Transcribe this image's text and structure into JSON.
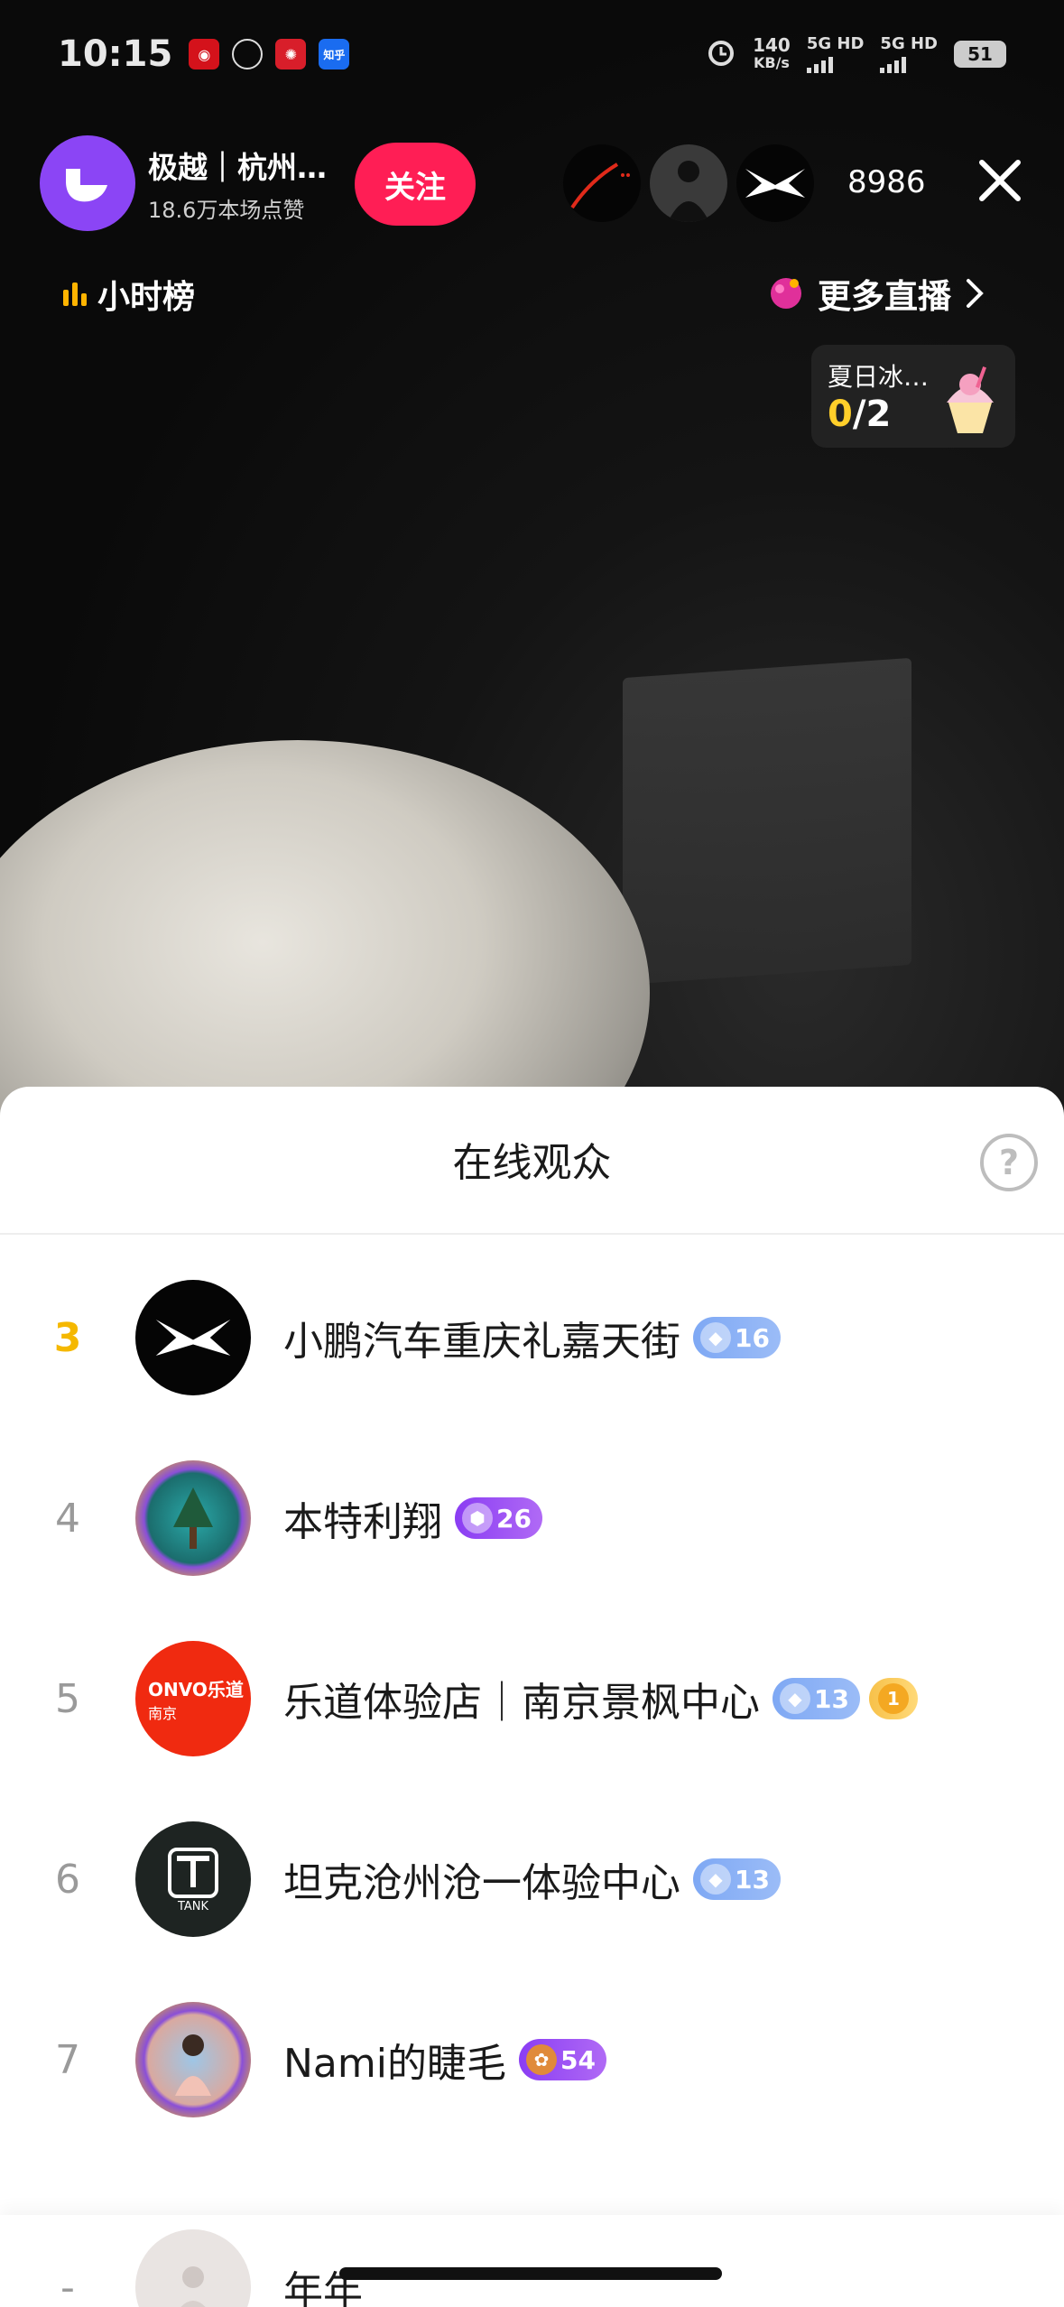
{
  "status_bar": {
    "time": "10:15",
    "speed_value": "140",
    "speed_unit": "KB/s",
    "sim1": "5G HD",
    "sim2": "5G HD",
    "battery": "51",
    "app_icons": [
      "netease-music-icon",
      "chat-icon",
      "weibo-icon",
      "zhihu-icon"
    ],
    "zhihu_label": "知乎"
  },
  "live": {
    "host_name": "极越｜杭州…",
    "host_likes": "18.6万本场点赞",
    "follow_label": "关注",
    "viewer_count": "8986",
    "rank_link": "小时榜",
    "more_live": "更多直播",
    "task_title": "夏日冰…",
    "task_done": "0",
    "task_total": "/2"
  },
  "sheet": {
    "title": "在线观众",
    "help": "?",
    "rows": [
      {
        "rank": "3",
        "name": "小鹏汽车重庆礼嘉天街",
        "level": "16",
        "badge": "blue"
      },
      {
        "rank": "4",
        "name": "本特利翔",
        "level": "26",
        "badge": "purple"
      },
      {
        "rank": "5",
        "name": "乐道体验店｜南京景枫中心",
        "level": "13",
        "badge": "blue",
        "extra_badge": "1"
      },
      {
        "rank": "6",
        "name": "坦克沧州沧一体验中心",
        "level": "13",
        "badge": "blue"
      },
      {
        "rank": "7",
        "name": "Nami的睫毛",
        "level": "54",
        "badge": "purple"
      },
      {
        "rank": "-",
        "name": "年年"
      }
    ],
    "avatar_texts": {
      "onvo_top": "ONVO乐道",
      "onvo_bottom": "南京",
      "tank": "TANK"
    }
  },
  "colors": {
    "follow": "#ff1e55",
    "rank_top": "#f5b800",
    "badge_blue": "#7ea8f4",
    "badge_purple": "#8a3df3"
  }
}
